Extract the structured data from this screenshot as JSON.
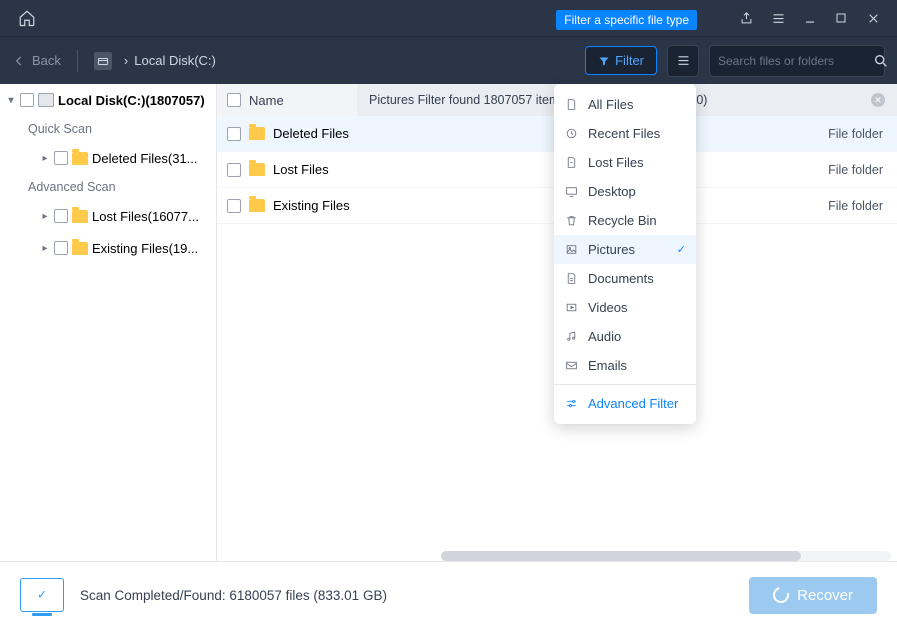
{
  "tooltip": "Filter a specific file type",
  "toolbar": {
    "back": "Back",
    "breadcrumb_sep": "›",
    "breadcrumb_drive": "Local Disk(C:)",
    "filter": "Filter",
    "search_placeholder": "Search files or folders"
  },
  "sidebar": {
    "root": "Local Disk(C:)(1807057)",
    "quick": "Quick Scan",
    "advanced": "Advanced Scan",
    "items": {
      "deleted": "Deleted Files(31...",
      "lost": "Lost Files(16077...",
      "existing": "Existing Files(19..."
    }
  },
  "columns": {
    "name": "Name"
  },
  "banner": {
    "text": "Pictures Filter found 1807057 item",
    "count_tail": "00)"
  },
  "files": [
    {
      "name": "Deleted Files",
      "type": "File folder"
    },
    {
      "name": "Lost Files",
      "type": "File folder"
    },
    {
      "name": "Existing Files",
      "type": "File folder"
    }
  ],
  "dropdown": {
    "all": "All Files",
    "recent": "Recent Files",
    "lost": "Lost Files",
    "desktop": "Desktop",
    "recycle": "Recycle Bin",
    "pictures": "Pictures",
    "documents": "Documents",
    "videos": "Videos",
    "audio": "Audio",
    "emails": "Emails",
    "advanced": "Advanced Filter"
  },
  "footer": {
    "status": "Scan Completed/Found: 6180057 files (833.01 GB)",
    "recover": "Recover"
  }
}
